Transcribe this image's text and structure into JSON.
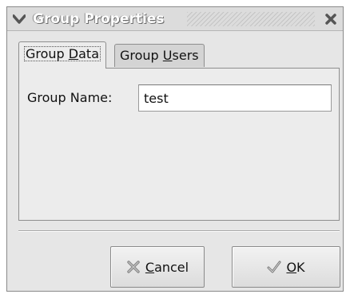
{
  "window": {
    "title": "Group Properties"
  },
  "tabs": [
    {
      "label_prefix": "Group ",
      "mnemonic": "D",
      "label_suffix": "ata",
      "active": true
    },
    {
      "label_prefix": "Group ",
      "mnemonic": "U",
      "label_suffix": "sers",
      "active": false
    }
  ],
  "form": {
    "group_name_label": "Group Name:",
    "group_name_value": "test"
  },
  "buttons": {
    "cancel": {
      "mnemonic": "C",
      "label_suffix": "ancel",
      "icon": "cancel-x-icon"
    },
    "ok": {
      "mnemonic": "O",
      "label_suffix": "K",
      "icon": "checkmark-icon"
    }
  },
  "colors": {
    "window_bg": "#e6e6e6",
    "panel_bg": "#ececec",
    "title_text": "#ffffff"
  }
}
